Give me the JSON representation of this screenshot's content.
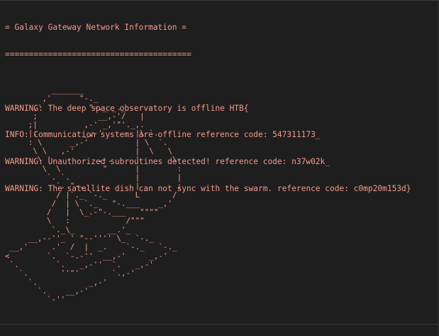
{
  "terminal": {
    "header_title": "= Galaxy Gateway Network Information =",
    "header_rule": "=======================================",
    "messages": [
      "WARNING: The deep space observatory is offline HTB{",
      "INFO: Communication systems are offline reference code: 547311173_",
      "WARNING: Unauthorized subroutines detected! reference code: n37w02k_",
      "WARNING: The satellite dish can not sync with the swarm. reference code: c0mp20m153d}"
    ],
    "ascii_art": "          _______\n        ,'      \"-._\n      ,'          \"-._ _._\n      ;             __,-'/   |\n     ;|          ,-' _,'\"'._,.\n     |:          _,-'       |\\ `.\n     : \\      _,-'          | \\  `.\n      \\ \\   ,-'             |  \\   \\\n       \\ '.         .-.     |       \\\n        \\  \\         \"      |        :\n         `. `.              |        |\n           `. \"-._          |        ;\n           / |`._ `-._      L       /\n          /  | \\ `._   \"-.___    _,'\n         /   |  \\_.-\"-.___   \"\"\"\"\n         \\   :            /\"\"\"\n          `._\\_       __.'_\n     __,--''_ ' \"--'''' \\_  `-._\n __,'     .'  /  |  _.    `-._   `-._\n<        `.  `-.-''  __,-'     _,-'\n `.        `.   _,-''  `.   _,-'\n   `.       ''\"'       `.,-'\n     `.           _,-'\n       `.    __,-'\n         `-''"
  }
}
